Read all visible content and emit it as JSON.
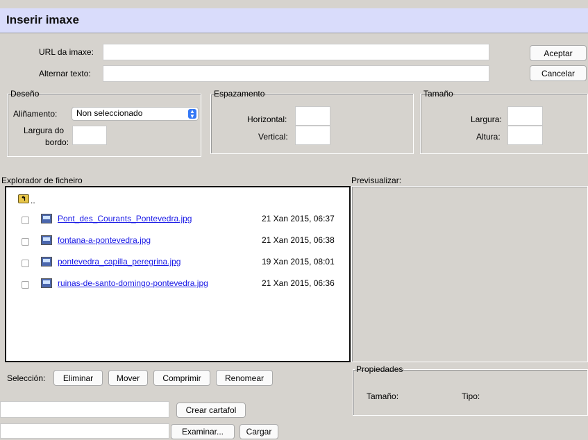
{
  "dialog": {
    "title": "Inserir imaxe"
  },
  "form": {
    "url_label": "URL da imaxe:",
    "url_value": "",
    "alt_label": "Alternar texto:",
    "alt_value": "",
    "ok_label": "Aceptar",
    "cancel_label": "Cancelar"
  },
  "design": {
    "legend": "Deseño",
    "align_label": "Aliñamento:",
    "align_value": "Non seleccionado",
    "border_label_1": "Largura do",
    "border_label_2": "bordo:",
    "border_value": ""
  },
  "spacing": {
    "legend": "Espazamento",
    "horizontal_label": "Horizontal:",
    "horizontal_value": "",
    "vertical_label": "Vertical:",
    "vertical_value": ""
  },
  "size": {
    "legend": "Tamaño",
    "width_label": "Largura:",
    "width_value": "",
    "height_label": "Altura:",
    "height_value": ""
  },
  "browser": {
    "label": "Explorador de ficheiro",
    "parent": "..",
    "files": [
      {
        "name": "Pont_des_Courants_Pontevedra.jpg",
        "date": "21 Xan 2015, 06:37"
      },
      {
        "name": "fontana-a-pontevedra.jpg",
        "date": "21 Xan 2015, 06:38"
      },
      {
        "name": "pontevedra_capilla_peregrina.jpg",
        "date": "19 Xan 2015, 08:01"
      },
      {
        "name": "ruinas-de-santo-domingo-pontevedra.jpg",
        "date": "21 Xan 2015, 06:36"
      }
    ]
  },
  "preview": {
    "label": "Previsualizar:"
  },
  "selection": {
    "label": "Selección:",
    "delete_label": "Eliminar",
    "move_label": "Mover",
    "compress_label": "Comprimir",
    "rename_label": "Renomear"
  },
  "properties": {
    "legend": "Propiedades",
    "size_label": "Tamaño:",
    "type_label": "Tipo:"
  },
  "folder": {
    "value": "",
    "create_label": "Crear cartafol"
  },
  "upload": {
    "value": "",
    "browse_label": "Examinar...",
    "upload_label": "Cargar"
  },
  "icons": [
    "folder-up-icon",
    "image-file-icon",
    "select-chevron-icon"
  ]
}
